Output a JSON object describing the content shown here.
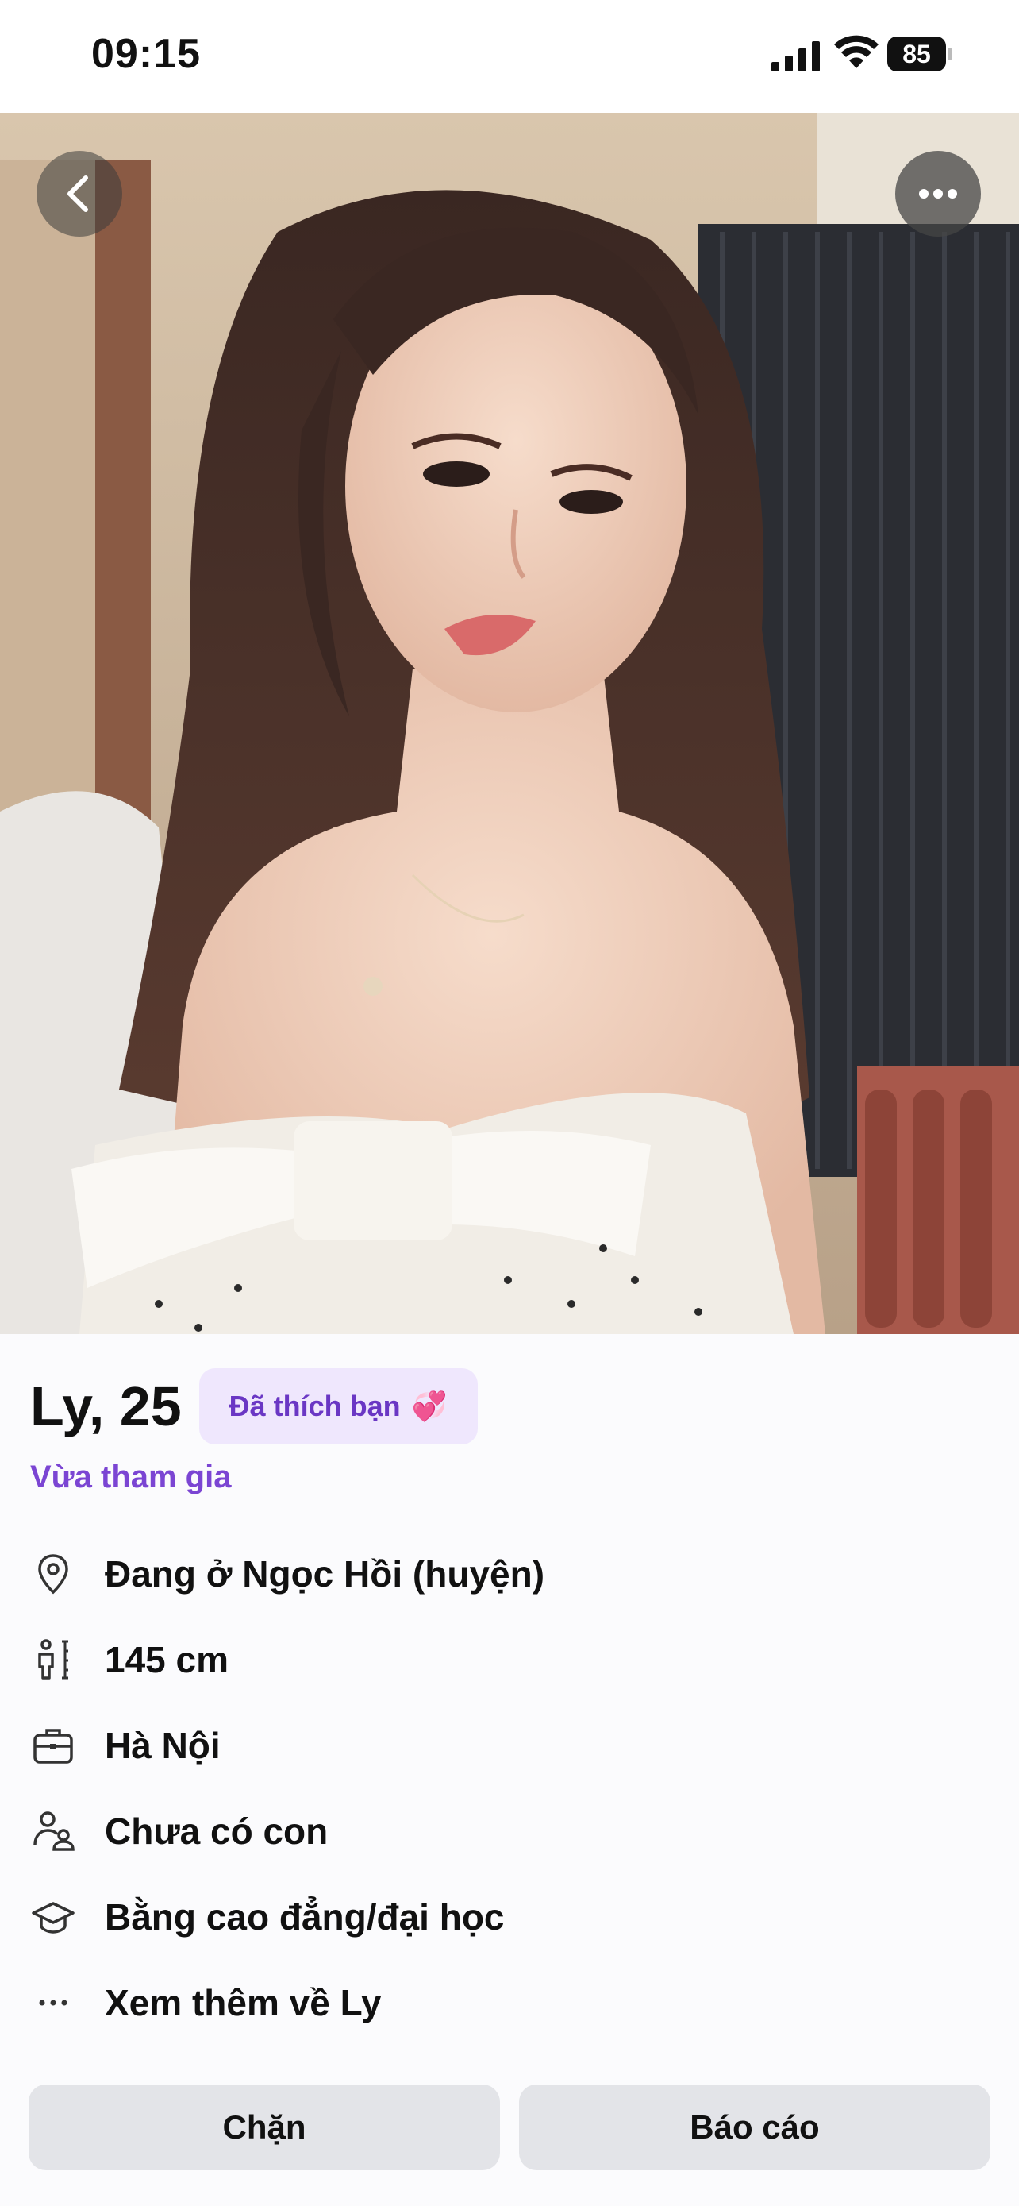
{
  "status_bar": {
    "time": "09:15",
    "battery": "85"
  },
  "profile": {
    "name_age": "Ly, 25",
    "liked_badge": "Đã thích bạn",
    "liked_badge_icon": "sparkling-heart-icon",
    "joined_label": "Vừa tham gia",
    "details": [
      {
        "icon": "location-pin-icon",
        "text": "Đang ở Ngọc Hồi (huyện)"
      },
      {
        "icon": "height-icon",
        "text": "145 cm"
      },
      {
        "icon": "briefcase-icon",
        "text": "Hà Nội"
      },
      {
        "icon": "parent-child-icon",
        "text": "Chưa có con"
      },
      {
        "icon": "graduation-cap-icon",
        "text": "Bằng cao đẳng/đại học"
      },
      {
        "icon": "more-dots-icon",
        "text": "Xem thêm về Ly"
      }
    ]
  },
  "actions": {
    "block_label": "Chặn",
    "report_label": "Báo cáo"
  },
  "colors": {
    "accent": "#7b45d3",
    "badge_bg": "#efe7fd",
    "button_bg": "#e3e4e8"
  }
}
